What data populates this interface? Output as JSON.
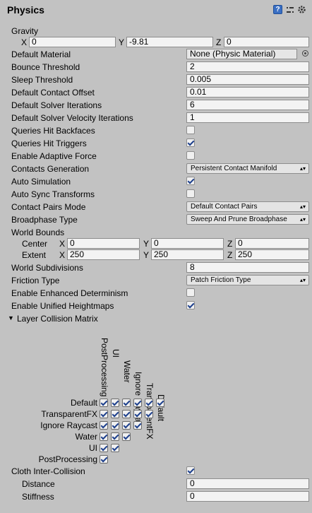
{
  "header": {
    "title": "Physics"
  },
  "gravity": {
    "label": "Gravity",
    "x_label": "X",
    "x": "0",
    "y_label": "Y",
    "y": "-9.81",
    "z_label": "Z",
    "z": "0"
  },
  "props": {
    "default_material": {
      "label": "Default Material",
      "value": "None (Physic Material)"
    },
    "bounce_threshold": {
      "label": "Bounce Threshold",
      "value": "2"
    },
    "sleep_threshold": {
      "label": "Sleep Threshold",
      "value": "0.005"
    },
    "default_contact_offset": {
      "label": "Default Contact Offset",
      "value": "0.01"
    },
    "default_solver_iterations": {
      "label": "Default Solver Iterations",
      "value": "6"
    },
    "default_solver_velocity_iterations": {
      "label": "Default Solver Velocity Iterations",
      "value": "1"
    },
    "queries_hit_backfaces": {
      "label": "Queries Hit Backfaces",
      "checked": false
    },
    "queries_hit_triggers": {
      "label": "Queries Hit Triggers",
      "checked": true
    },
    "enable_adaptive_force": {
      "label": "Enable Adaptive Force",
      "checked": false
    },
    "contacts_generation": {
      "label": "Contacts Generation",
      "value": "Persistent Contact Manifold"
    },
    "auto_simulation": {
      "label": "Auto Simulation",
      "checked": true
    },
    "auto_sync_transforms": {
      "label": "Auto Sync Transforms",
      "checked": false
    },
    "contact_pairs_mode": {
      "label": "Contact Pairs Mode",
      "value": "Default Contact Pairs"
    },
    "broadphase_type": {
      "label": "Broadphase Type",
      "value": "Sweep And Prune Broadphase"
    }
  },
  "world_bounds": {
    "label": "World Bounds",
    "center": {
      "label": "Center",
      "x": "0",
      "y": "0",
      "z": "0"
    },
    "extent": {
      "label": "Extent",
      "x": "250",
      "y": "250",
      "z": "250"
    },
    "x_label": "X",
    "y_label": "Y",
    "z_label": "Z"
  },
  "props2": {
    "world_subdivisions": {
      "label": "World Subdivisions",
      "value": "8"
    },
    "friction_type": {
      "label": "Friction Type",
      "value": "Patch Friction Type"
    },
    "enhanced_determinism": {
      "label": "Enable Enhanced Determinism",
      "checked": false
    },
    "unified_heightmaps": {
      "label": "Enable Unified Heightmaps",
      "checked": true
    }
  },
  "matrix": {
    "label": "Layer Collision Matrix",
    "columns": [
      "PostProcessing",
      "UI",
      "Water",
      "Ignore Raycast",
      "TransparentFX",
      "Default"
    ],
    "rows": [
      "Default",
      "TransparentFX",
      "Ignore Raycast",
      "Water",
      "UI",
      "PostProcessing"
    ],
    "checked": [
      [
        true,
        true,
        true,
        true,
        true,
        true
      ],
      [
        true,
        true,
        true,
        true,
        true
      ],
      [
        true,
        true,
        true,
        true
      ],
      [
        true,
        true,
        true
      ],
      [
        true,
        true
      ],
      [
        true
      ]
    ]
  },
  "cloth": {
    "label": "Cloth Inter-Collision",
    "checked": true,
    "distance": {
      "label": "Distance",
      "value": "0"
    },
    "stiffness": {
      "label": "Stiffness",
      "value": "0"
    }
  },
  "icons": [
    "help-icon",
    "preset-icon",
    "settings-icon"
  ]
}
